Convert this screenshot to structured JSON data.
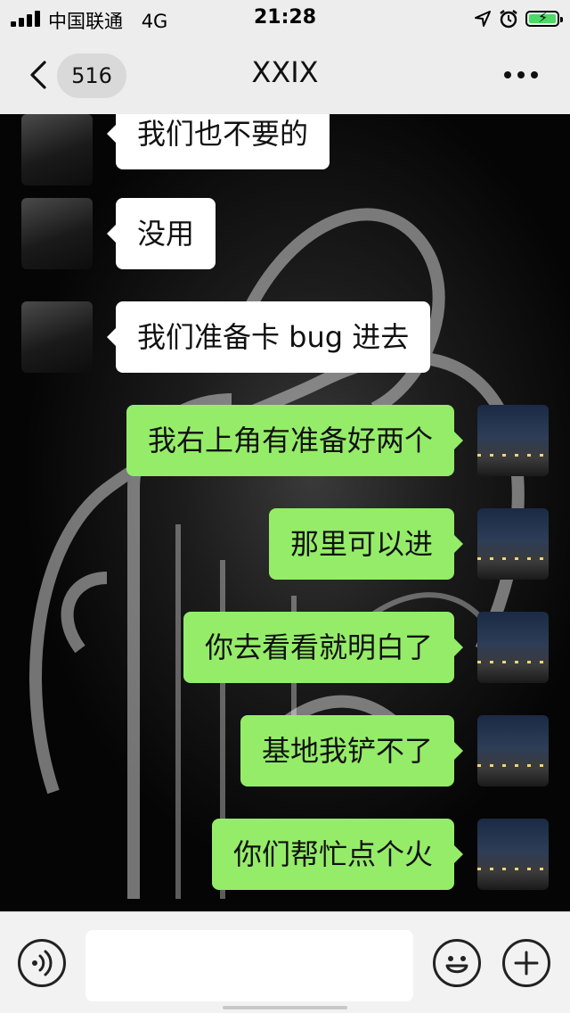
{
  "status_bar": {
    "carrier": "中国联通",
    "network": "4G",
    "time": "21:28",
    "battery_charging": true,
    "battery_color": "#4cd964",
    "icons": [
      "signal-icon",
      "location-icon",
      "alarm-icon",
      "battery-icon"
    ]
  },
  "nav": {
    "back_icon": "chevron-left-icon",
    "unread_count": "516",
    "title": "XXIX",
    "more_icon": "ellipsis-icon"
  },
  "messages": [
    {
      "side": "them",
      "text": "我们也不要的"
    },
    {
      "side": "them",
      "text": "没用"
    },
    {
      "side": "them",
      "text": "我们准备卡 bug 进去"
    },
    {
      "side": "me",
      "text": "我右上角有准备好两个"
    },
    {
      "side": "me",
      "text": "那里可以进"
    },
    {
      "side": "me",
      "text": "你去看看就明白了"
    },
    {
      "side": "me",
      "text": "基地我铲不了"
    },
    {
      "side": "me",
      "text": "你们帮忙点个火"
    }
  ],
  "input_bar": {
    "voice_icon": "voice-icon",
    "text_value": "",
    "emoji_icon": "emoji-icon",
    "plus_icon": "plus-icon"
  },
  "colors": {
    "my_bubble": "#95ec69",
    "their_bubble": "#ffffff",
    "header_bg": "#ededed"
  }
}
